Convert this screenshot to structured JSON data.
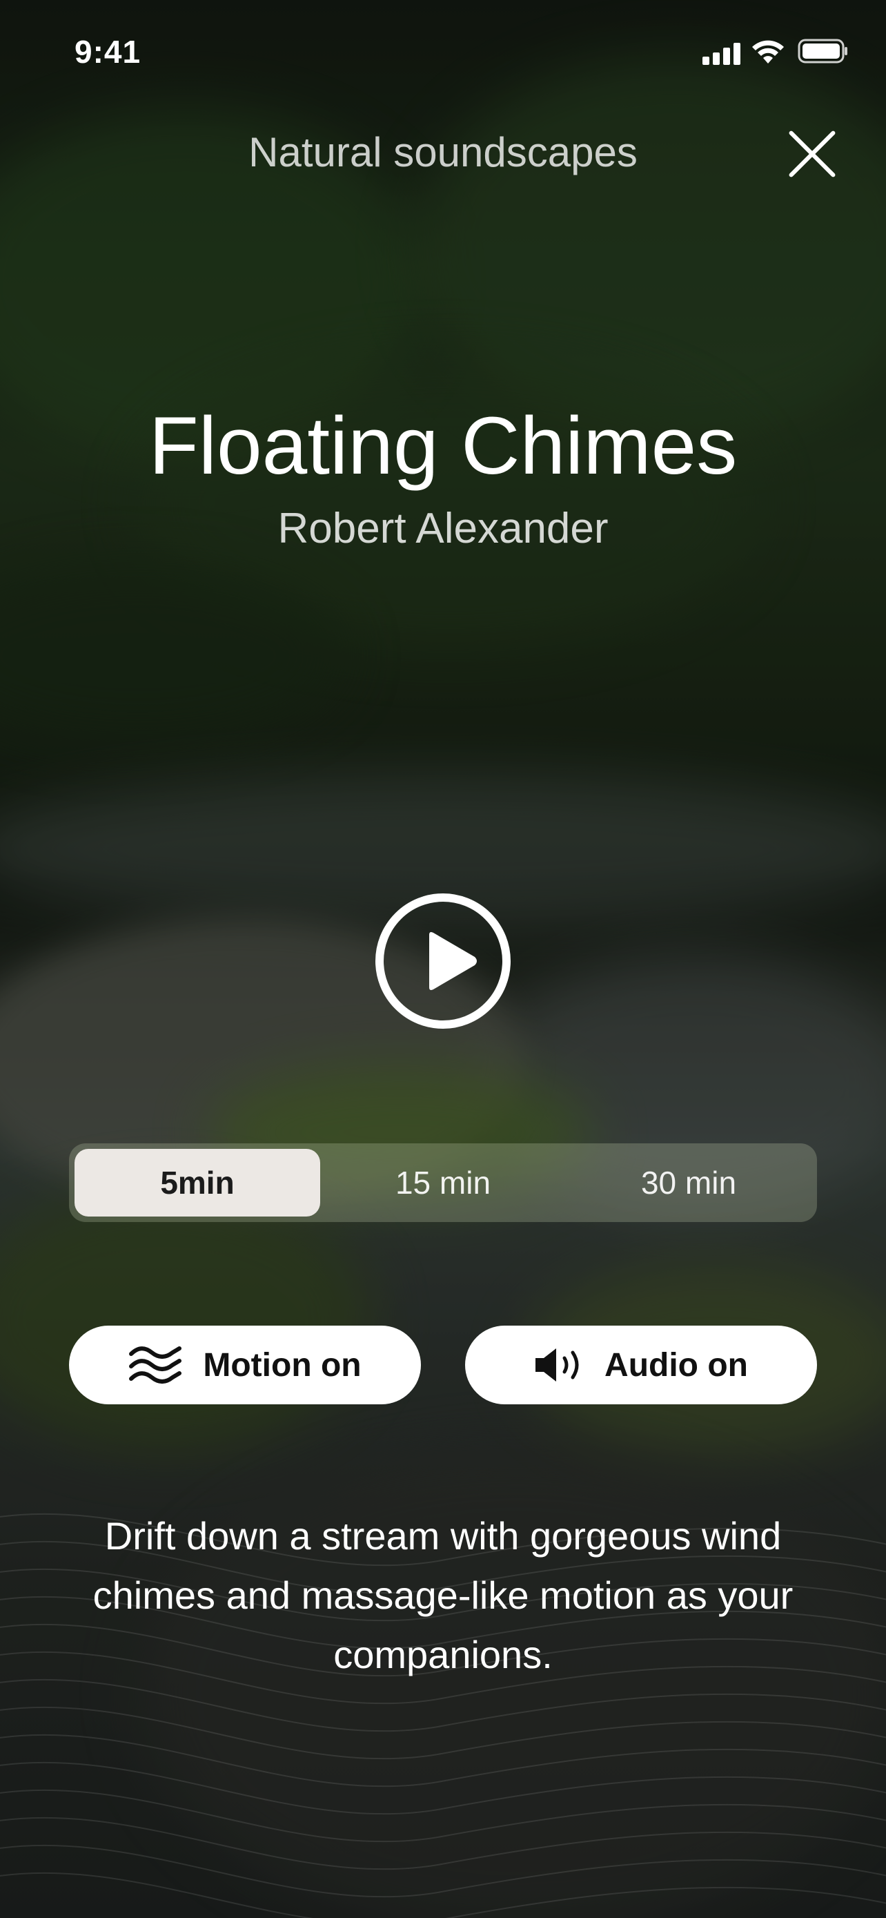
{
  "status_bar": {
    "time": "9:41"
  },
  "header": {
    "category": "Natural soundscapes",
    "close_icon": "close-icon"
  },
  "track": {
    "title": "Floating Chimes",
    "artist": "Robert Alexander"
  },
  "player": {
    "play_icon": "play-icon"
  },
  "durations": {
    "selected": "5min",
    "options": [
      "5min",
      "15 min",
      "30 min"
    ]
  },
  "toggles": {
    "motion": {
      "label": "Motion on",
      "icon": "waves-icon"
    },
    "audio": {
      "label": "Audio on",
      "icon": "speaker-icon"
    }
  },
  "description": "Drift down a stream with gorgeous wind chimes and massage-like motion as your companions."
}
